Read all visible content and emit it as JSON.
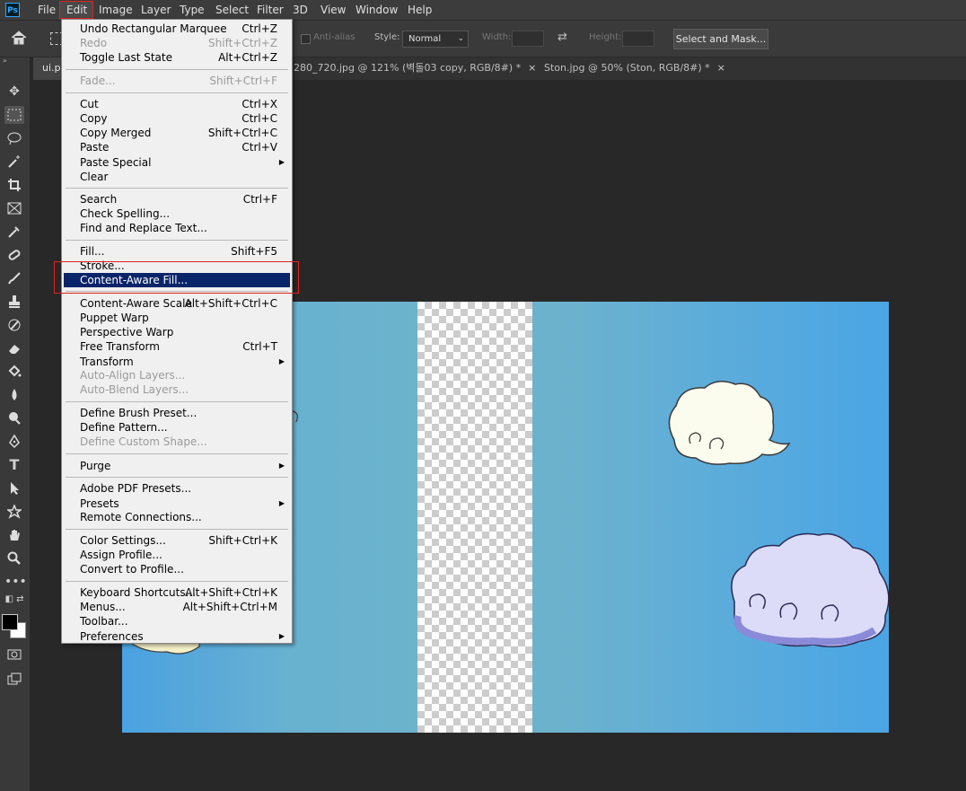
{
  "app": {
    "logo": "Ps"
  },
  "menubar": [
    "File",
    "Edit",
    "Image",
    "Layer",
    "Type",
    "Select",
    "Filter",
    "3D",
    "View",
    "Window",
    "Help"
  ],
  "options": {
    "anti_alias": "Anti-alias",
    "style_label": "Style:",
    "style_value": "Normal",
    "width_label": "Width:",
    "height_label": "Height:",
    "select_mask": "Select and Mask..."
  },
  "tabs": [
    {
      "label": "ui.p",
      "close": ""
    },
    {
      "label": "280_720.jpg @ 121% (벽돌03 copy, RGB/8#) *",
      "close": "×"
    },
    {
      "label": "Ston.jpg @ 50% (Ston, RGB/8#) *",
      "close": "×"
    }
  ],
  "toolbar": {
    "grip": "»",
    "tools": [
      "move-icon",
      "rectangular-marquee-icon",
      "lasso-icon",
      "magic-wand-icon",
      "crop-icon",
      "frame-icon",
      "eyedropper-icon",
      "healing-brush-icon",
      "brush-icon",
      "clone-stamp-icon",
      "history-brush-icon",
      "eraser-icon",
      "paint-bucket-icon",
      "blur-icon",
      "dodge-icon",
      "pen-icon",
      "type-icon",
      "path-selection-icon",
      "custom-shape-icon",
      "hand-icon",
      "zoom-icon",
      "more-tools-icon"
    ],
    "foreground_color": "#000000",
    "background_color": "#ffffff"
  },
  "edit_menu": {
    "items": [
      {
        "label": "Undo Rectangular Marquee",
        "shortcut": "Ctrl+Z",
        "disabled": false
      },
      {
        "label": "Redo",
        "shortcut": "Shift+Ctrl+Z",
        "disabled": true
      },
      {
        "label": "Toggle Last State",
        "shortcut": "Alt+Ctrl+Z",
        "disabled": false
      },
      {
        "label": "Fade...",
        "shortcut": "Shift+Ctrl+F",
        "disabled": true
      },
      {
        "label": "Cut",
        "shortcut": "Ctrl+X",
        "disabled": false
      },
      {
        "label": "Copy",
        "shortcut": "Ctrl+C",
        "disabled": false
      },
      {
        "label": "Copy Merged",
        "shortcut": "Shift+Ctrl+C",
        "disabled": false
      },
      {
        "label": "Paste",
        "shortcut": "Ctrl+V",
        "disabled": false
      },
      {
        "label": "Paste Special",
        "shortcut": "",
        "submenu": true
      },
      {
        "label": "Clear",
        "shortcut": ""
      },
      {
        "label": "Search",
        "shortcut": "Ctrl+F"
      },
      {
        "label": "Check Spelling...",
        "shortcut": ""
      },
      {
        "label": "Find and Replace Text...",
        "shortcut": ""
      },
      {
        "label": "Fill...",
        "shortcut": "Shift+F5"
      },
      {
        "label": "Stroke...",
        "shortcut": ""
      },
      {
        "label": "Content-Aware Fill...",
        "shortcut": "",
        "selected": true
      },
      {
        "label": "Content-Aware Scale",
        "shortcut": "Alt+Shift+Ctrl+C"
      },
      {
        "label": "Puppet Warp",
        "shortcut": ""
      },
      {
        "label": "Perspective Warp",
        "shortcut": ""
      },
      {
        "label": "Free Transform",
        "shortcut": "Ctrl+T"
      },
      {
        "label": "Transform",
        "shortcut": "",
        "submenu": true
      },
      {
        "label": "Auto-Align Layers...",
        "shortcut": "",
        "disabled": true
      },
      {
        "label": "Auto-Blend Layers...",
        "shortcut": "",
        "disabled": true
      },
      {
        "label": "Define Brush Preset...",
        "shortcut": ""
      },
      {
        "label": "Define Pattern...",
        "shortcut": ""
      },
      {
        "label": "Define Custom Shape...",
        "shortcut": "",
        "disabled": true
      },
      {
        "label": "Purge",
        "shortcut": "",
        "submenu": true
      },
      {
        "label": "Adobe PDF Presets...",
        "shortcut": ""
      },
      {
        "label": "Presets",
        "shortcut": "",
        "submenu": true
      },
      {
        "label": "Remote Connections...",
        "shortcut": ""
      },
      {
        "label": "Color Settings...",
        "shortcut": "Shift+Ctrl+K"
      },
      {
        "label": "Assign Profile...",
        "shortcut": ""
      },
      {
        "label": "Convert to Profile...",
        "shortcut": ""
      },
      {
        "label": "Keyboard Shortcuts...",
        "shortcut": "Alt+Shift+Ctrl+K"
      },
      {
        "label": "Menus...",
        "shortcut": "Alt+Shift+Ctrl+M"
      },
      {
        "label": "Toolbar...",
        "shortcut": ""
      },
      {
        "label": "Preferences",
        "shortcut": "",
        "submenu": true
      }
    ]
  }
}
